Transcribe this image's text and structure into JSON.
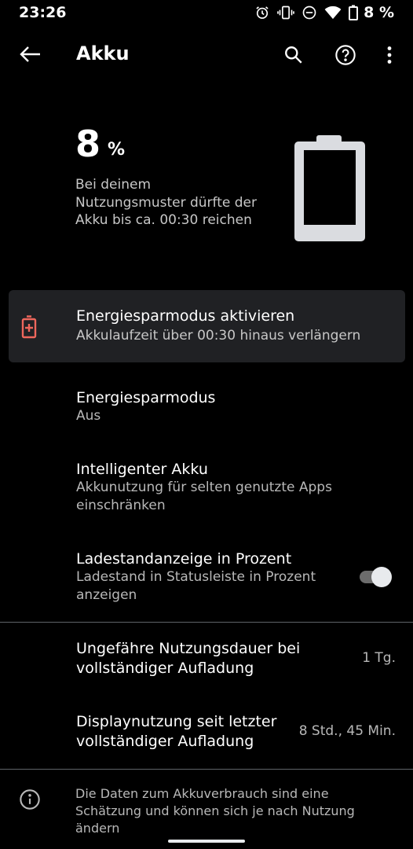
{
  "status_bar": {
    "time": "23:26",
    "battery_percent": "8 %",
    "icons": [
      "alarm-icon",
      "vibrate-icon",
      "do-not-disturb-icon",
      "wifi-icon",
      "battery-icon"
    ]
  },
  "app_bar": {
    "title": "Akku",
    "actions": [
      "back-arrow-icon",
      "search-icon",
      "help-icon",
      "more-vert-icon"
    ]
  },
  "hero": {
    "value": "8",
    "unit": "%",
    "description": "Bei deinem Nutzungsmuster dürfte der Akku bis ca. 00:30 reichen",
    "level_fraction": 0.08
  },
  "suggestion": {
    "title": "Energiesparmodus aktivieren",
    "subtitle": "Akkulaufzeit über 00:30 hinaus verlängern",
    "icon": "battery-plus-icon",
    "accent": "#ee675c"
  },
  "settings": {
    "battery_saver": {
      "title": "Energiesparmodus",
      "subtitle": "Aus"
    },
    "adaptive_battery": {
      "title": "Intelligenter Akku",
      "subtitle": "Akkunutzung für selten genutzte Apps einschränken"
    },
    "battery_percentage": {
      "title": "Ladestandanzeige in Prozent",
      "subtitle": "Ladestand in Statusleiste in Prozent anzeigen",
      "enabled": true
    }
  },
  "usage": {
    "full_charge": {
      "title": "Ungefähre Nutzungsdauer bei vollständiger Aufladung",
      "value": "1 Tg."
    },
    "screen_usage": {
      "title": "Displaynutzung seit letzter vollständiger Aufladung",
      "value": "8 Std., 45 Min."
    }
  },
  "footer": {
    "info_text": "Die Daten zum Akkuverbrauch sind eine Schätzung und können sich je nach Nutzung ändern",
    "icon": "info-icon"
  },
  "colors": {
    "background": "#000000",
    "card": "#202124",
    "accent_red": "#ee675c",
    "secondary_text": "#b8b8b8",
    "battery_graphic": "#dadce0"
  }
}
